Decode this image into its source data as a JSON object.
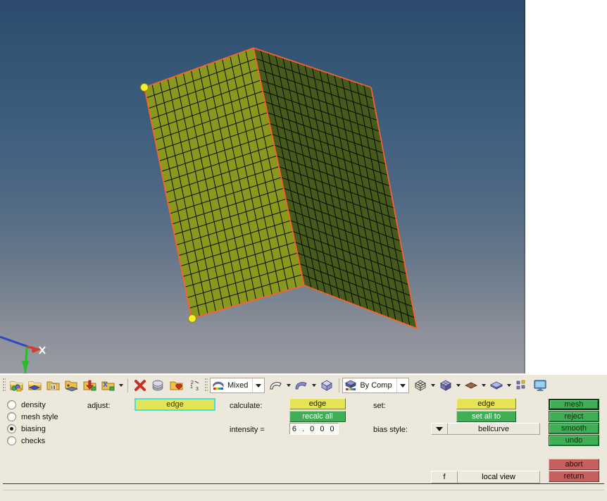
{
  "viewport": {
    "name": "3d-viewport",
    "background_top": "#2c4a6e",
    "background_bottom": "#9a9ca4",
    "axis_gizmo": {
      "x_label": "X",
      "x_color": "#d43a2a",
      "y_color": "#22c222",
      "z_color": "#2a42c4"
    },
    "mesh": {
      "front_face_color": "#8b9a1e",
      "back_face_color": "#44571a",
      "wire_color": "#000000",
      "border_color": "#ff5a2a",
      "vertex_color": "#f2ec3a",
      "front_cols": 14,
      "front_rows": 22,
      "back_cols": 16,
      "back_rows": 22
    }
  },
  "toolbar": {
    "name": "main-toolbar",
    "groups": [
      {
        "items": [
          {
            "icon": "folder-objects-icon",
            "label": ""
          },
          {
            "icon": "folder-layer-icon",
            "label": ""
          },
          {
            "icon": "folder-properties-icon",
            "label": ""
          },
          {
            "icon": "folder-new-layer-icon",
            "label": ""
          },
          {
            "icon": "folder-import-icon",
            "label": ""
          },
          {
            "icon": "folder-tools-icon",
            "label": "",
            "has_caret": true
          }
        ]
      },
      {
        "items": [
          {
            "icon": "delete-red-x-icon",
            "label": ""
          },
          {
            "icon": "copy-stack-icon",
            "label": ""
          },
          {
            "icon": "folder-heart-icon",
            "label": ""
          },
          {
            "icon": "numbered-order-icon",
            "label": ""
          }
        ]
      },
      {
        "items": [
          {
            "icon": "shading-mode-icon",
            "label": "Mixed",
            "is_combo": true
          },
          {
            "icon": "curve-open-icon",
            "label": "",
            "has_caret": true
          },
          {
            "icon": "surface-icon",
            "label": "",
            "has_caret": true
          },
          {
            "icon": "cube-solid-icon",
            "label": ""
          }
        ]
      },
      {
        "items": [
          {
            "icon": "color-by-icon",
            "label": "By Comp",
            "is_combo": true
          },
          {
            "icon": "wire-cube-icon",
            "label": "",
            "has_caret": true
          },
          {
            "icon": "shaded-cube-icon",
            "label": "",
            "has_caret": true
          },
          {
            "icon": "plane-brown-icon",
            "label": "",
            "has_caret": true
          },
          {
            "icon": "plane-blue-icon",
            "label": "",
            "has_caret": true
          },
          {
            "icon": "component-grid-icon",
            "label": ""
          },
          {
            "icon": "monitor-screen-icon",
            "label": ""
          }
        ]
      }
    ],
    "combo_mixed_label": "Mixed",
    "combo_bycomp_label": "By Comp"
  },
  "panel": {
    "name": "mesh-biasing-panel",
    "mode_radios": [
      {
        "label": "density",
        "selected": false
      },
      {
        "label": "mesh style",
        "selected": false
      },
      {
        "label": "biasing",
        "selected": true
      },
      {
        "label": "checks",
        "selected": false
      }
    ],
    "adjust": {
      "label": "adjust:",
      "value": "edge",
      "highlight_color": "#49e0d2",
      "fill_color": "#e5e356"
    },
    "calculate": {
      "label": "calculate:",
      "target_button": "edge",
      "action_button": "recalc all"
    },
    "intensity": {
      "label": "intensity =",
      "value": "6 . 0 0 0"
    },
    "set": {
      "label": "set:",
      "target_button": "edge",
      "action_button": "set all to"
    },
    "bias_style": {
      "label": "bias style:",
      "value": "bellcurve"
    },
    "right_buttons": [
      {
        "label": "mesh",
        "style": "green",
        "selected": true
      },
      {
        "label": "reject",
        "style": "green",
        "selected": false
      },
      {
        "label": "smooth",
        "style": "green",
        "selected": false
      },
      {
        "label": "undo",
        "style": "green",
        "selected": false
      }
    ],
    "exit_buttons": [
      {
        "label": "abort",
        "style": "red"
      },
      {
        "label": "return",
        "style": "red"
      }
    ],
    "local_view": {
      "f_label": "f",
      "value": "local view"
    }
  }
}
